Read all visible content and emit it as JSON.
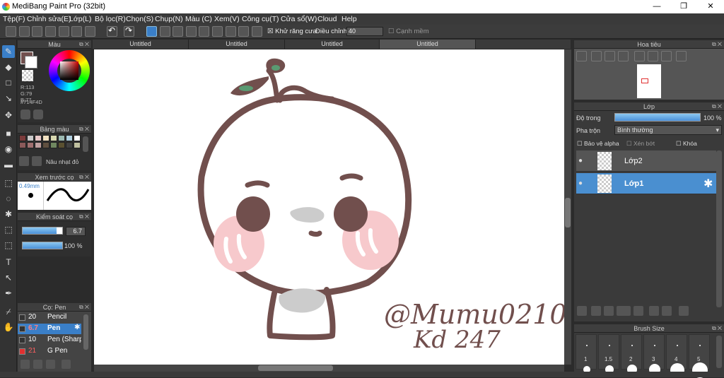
{
  "title": "MediBang Paint Pro (32bit)",
  "window": {
    "minimize": "—",
    "restore": "❐",
    "close": "✕"
  },
  "menu": [
    "Tệp(F)",
    "Chỉnh sửa(E)",
    "Lớp(L)",
    "Bộ lọc(R)",
    "Chọn(S)",
    "Chụp(N)",
    "Màu (C)",
    "Xem(V)",
    "Công cụ(T)",
    "Cửa sổ(W)",
    "Cloud",
    "Help"
  ],
  "toolbar": {
    "antialias": "Khử răng cưa",
    "adjust": "Điều chỉnh",
    "adjust_value": "40",
    "snap": "Cạnh mềm"
  },
  "tabs": [
    "Untitled",
    "Untitled",
    "Untitled",
    "Untitled"
  ],
  "color_panel": {
    "title": "Màu",
    "r": "R:113",
    "g": "G:79",
    "b": "B:77",
    "hex": "#714F4D",
    "fg": "#714F4D"
  },
  "palette": {
    "title": "Bảng màu",
    "name": "Nâu nhạt đỏ",
    "colors": [
      "#7b3b3b",
      "#c8c8c8",
      "#e8c8c8",
      "#f0e0c0",
      "#d8d8b0",
      "#9ab8b0",
      "#b0d0e0",
      "#ffffff",
      "#8b5a5a",
      "#a07070",
      "#c0a0a0",
      "#605040",
      "#708860",
      "#5a5030",
      "#404040",
      "#c0c0a0"
    ]
  },
  "preview": {
    "title": "Xem trước cọ",
    "size": "0.49mm"
  },
  "brush_control": {
    "title": "Kiểm soát cọ",
    "size": "6.7",
    "opacity": "100 %",
    "size_fill": 0.85,
    "opacity_fill": 1.0
  },
  "brushes": {
    "title": "Cọ: Pen",
    "items": [
      {
        "size": "20",
        "name": "Pencil",
        "color": "#333333"
      },
      {
        "size": "6.7",
        "name": "Pen",
        "color": "#333333",
        "selected": true
      },
      {
        "size": "10",
        "name": "Pen (Sharp)",
        "color": "#333333"
      },
      {
        "size": "21",
        "name": "G Pen",
        "color": "#e03030"
      }
    ]
  },
  "navigator": {
    "title": "Hoa tiêu"
  },
  "layer_panel": {
    "title": "Lớp",
    "opacity_label": "Độ trong",
    "opacity_value": "100 %",
    "blend_label": "Pha trộn",
    "blend_value": "Bình thường",
    "protect_alpha": "Bảo vệ alpha",
    "clip": "Xén bớt",
    "lock": "Khóa",
    "opacity_fill": 1.0,
    "layers": [
      {
        "name": "Lớp2",
        "selected": false
      },
      {
        "name": "Lớp1",
        "selected": true
      }
    ]
  },
  "brush_size": {
    "title": "Brush Size",
    "sizes": [
      "1",
      "1.5",
      "2",
      "3",
      "4",
      "5"
    ]
  },
  "signature": {
    "line1": "@Mumu0210",
    "line2": "Kd 247"
  }
}
